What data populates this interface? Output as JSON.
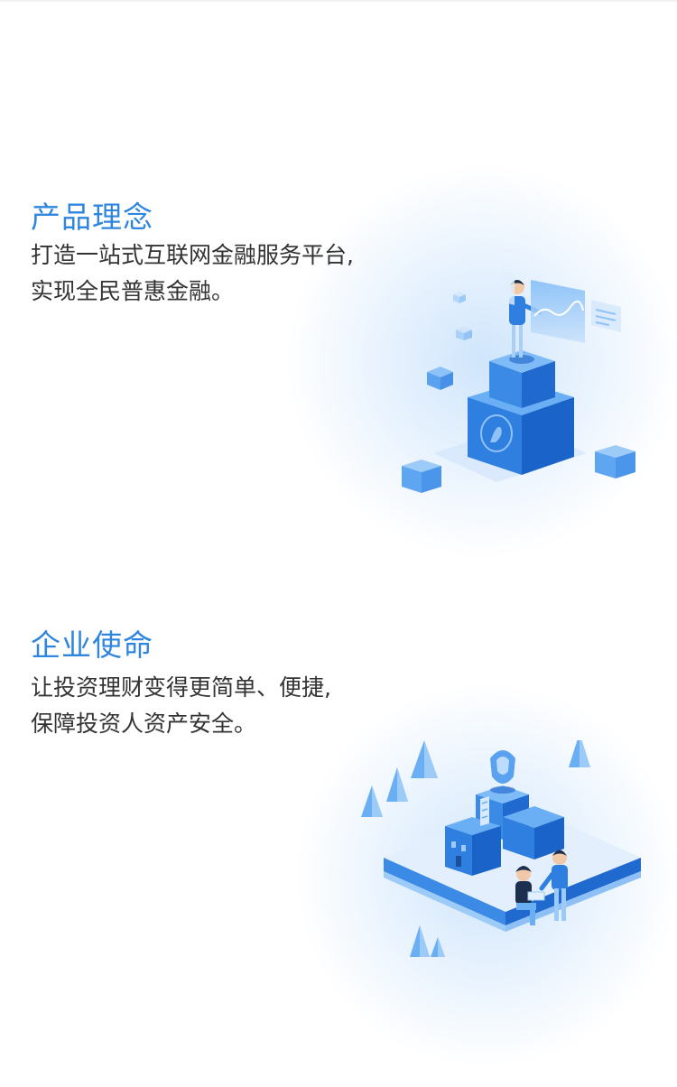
{
  "sections": [
    {
      "title": "产品理念",
      "lines": [
        "打造一站式互联网金融服务平台,",
        "实现全民普惠金融。"
      ]
    },
    {
      "title": "企业使命",
      "lines": [
        "让投资理财变得更简单、便捷,",
        "保障投资人资产安全。"
      ]
    }
  ],
  "colors": {
    "title": "#2e86de",
    "text": "#333333",
    "block_front": "#2f7fe0",
    "block_side": "#1a63c8",
    "block_top": "#63aaf3"
  }
}
